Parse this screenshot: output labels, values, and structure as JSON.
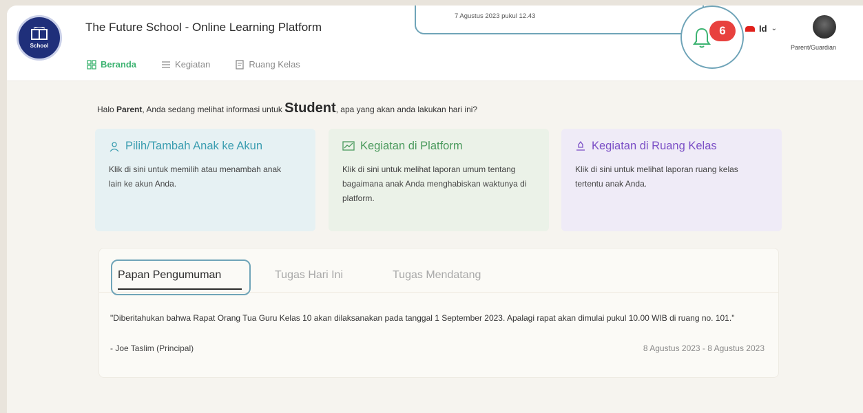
{
  "header": {
    "app_title": "The Future School - Online Learning Platform",
    "logo_text": "School",
    "nav": [
      {
        "label": "Beranda",
        "icon": "grid-icon",
        "active": true
      },
      {
        "label": "Kegiatan",
        "icon": "list-icon",
        "active": false
      },
      {
        "label": "Ruang Kelas",
        "icon": "document-icon",
        "active": false
      }
    ],
    "notification": {
      "popup_date": "7 Agustus 2023 pukul 12.43",
      "count": "6"
    },
    "language": "Id",
    "role": "Parent/Guardian"
  },
  "greeting": {
    "prefix": "Halo ",
    "user": "Parent",
    "middle": ", Anda sedang melihat informasi untuk ",
    "student": "Student",
    "suffix": ", apa yang akan anda lakukan hari ini?"
  },
  "cards": [
    {
      "title": "Pilih/Tambah Anak ke Akun",
      "desc": "Klik di sini untuk memilih atau menambah anak lain ke akun Anda.",
      "icon": "person-icon"
    },
    {
      "title": "Kegiatan di Platform",
      "desc": "Klik di sini untuk melihat laporan umum tentang bagaimana anak Anda menghabiskan waktunya di platform.",
      "icon": "chart-icon"
    },
    {
      "title": "Kegiatan di Ruang Kelas",
      "desc": "Klik di sini untuk melihat laporan ruang kelas tertentu anak Anda.",
      "icon": "classroom-icon"
    }
  ],
  "board": {
    "tabs": [
      "Papan Pengumuman",
      "Tugas Hari Ini",
      "Tugas Mendatang"
    ],
    "announcement": "\"Diberitahukan bahwa Rapat Orang Tua Guru Kelas 10 akan dilaksanakan pada tanggal 1 September 2023. Apalagi rapat akan dimulai pukul 10.00 WIB di ruang no. 101.\"",
    "author": "- Joe Taslim (Principal)",
    "date_range": "8 Agustus 2023 - 8 Agustus 2023"
  },
  "colors": {
    "accent": "#3cb371",
    "highlight": "#6fa4b8",
    "badge": "#e8413e"
  }
}
